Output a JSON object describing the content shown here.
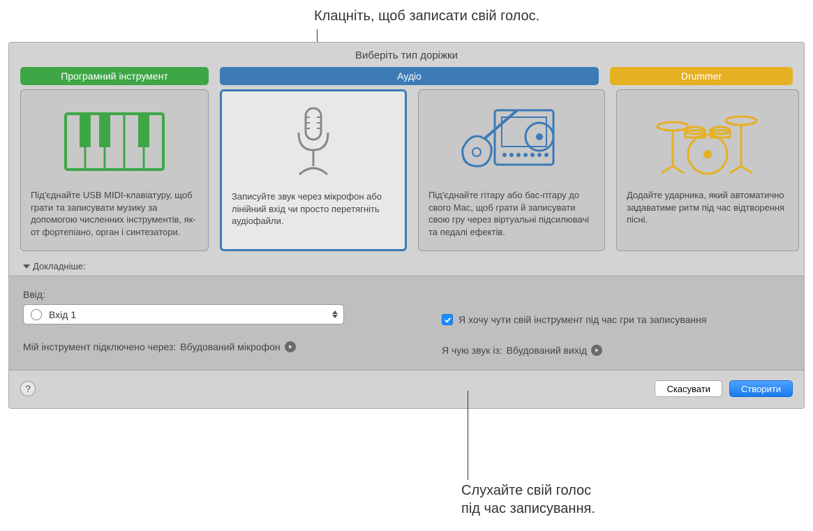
{
  "callouts": {
    "top": "Клацніть, щоб записати свій голос.",
    "bottom_line1": "Слухайте свій голос",
    "bottom_line2": "під час записування."
  },
  "dialog": {
    "title": "Виберіть тип доріжки"
  },
  "tabs": {
    "software": "Програмний інструмент",
    "audio": "Аудіо",
    "drummer": "Drummer"
  },
  "cards": {
    "software_desc": "Під'єднайте USB MIDI-клавіатуру, щоб грати та записувати музику за допомогою численних інструментів, як-от фортепіано, орган і синтезатори.",
    "audio_mic_desc": "Записуйте звук через мікрофон або лінійний вхід чи просто перетягніть аудіофайли.",
    "audio_guitar_desc": "Під'єднайте гітару або бас-гітару до свого Mac, щоб грати й записувати свою гру через віртуальні підсилювачі та педалі ефектів.",
    "drummer_desc": "Додайте ударника, який автоматично задаватиме ритм під час відтворення пісні."
  },
  "details": {
    "toggle": "Докладніше:",
    "input_label": "Ввід:",
    "input_value": "Вхід 1",
    "connected_label": "Мій інструмент підключено через:",
    "connected_value": "Вбудований мікрофон",
    "monitor_label": "Я хочу чути свій інструмент під час гри та записування",
    "output_label": "Я чую звук із:",
    "output_value": "Вбудований вихід"
  },
  "buttons": {
    "cancel": "Скасувати",
    "create": "Створити"
  },
  "colors": {
    "green": "#3fa648",
    "blue": "#3d7ab6",
    "yellow": "#e6b023"
  }
}
